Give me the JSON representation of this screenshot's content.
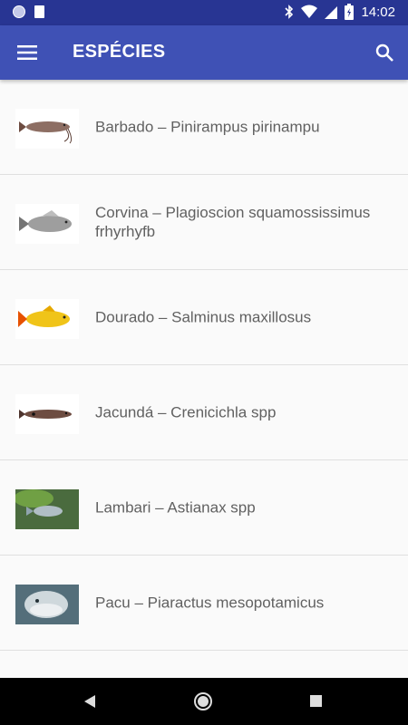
{
  "status_bar": {
    "time": "14:02",
    "icons": [
      "notification-dot-icon",
      "sd-card-icon",
      "bluetooth-icon",
      "wifi-icon",
      "signal-icon",
      "battery-charging-icon"
    ]
  },
  "app_bar": {
    "title": "ESPÉCIES",
    "menu_icon": "menu-icon",
    "search_icon": "search-icon"
  },
  "species": [
    {
      "label": "Barbado – Pinirampus pirinampu",
      "image": "catfish-image",
      "color": "#8d6e63"
    },
    {
      "label": "Corvina – Plagioscion squamossissimus frhyrhyfb",
      "image": "croaker-image",
      "color": "#9e9e9e"
    },
    {
      "label": "Dourado – Salminus maxillosus",
      "image": "golden-fish-image",
      "color": "#f0c419"
    },
    {
      "label": "Jacundá – Crenicichla spp",
      "image": "pike-cichlid-image",
      "color": "#6d4c41"
    },
    {
      "label": "Lambari – Astianax spp",
      "image": "tetra-photo",
      "color": "#b0bec5"
    },
    {
      "label": "Pacu – Piaractus mesopotamicus",
      "image": "pacu-photo",
      "color": "#90a4ae"
    }
  ],
  "nav_bar": {
    "icons": [
      "back-icon",
      "home-icon",
      "recents-icon"
    ]
  },
  "colors": {
    "status_bar": "#283593",
    "app_bar": "#3f51b5",
    "list_background": "#fafafa",
    "divider": "#e0e0e0",
    "text": "#616161"
  }
}
